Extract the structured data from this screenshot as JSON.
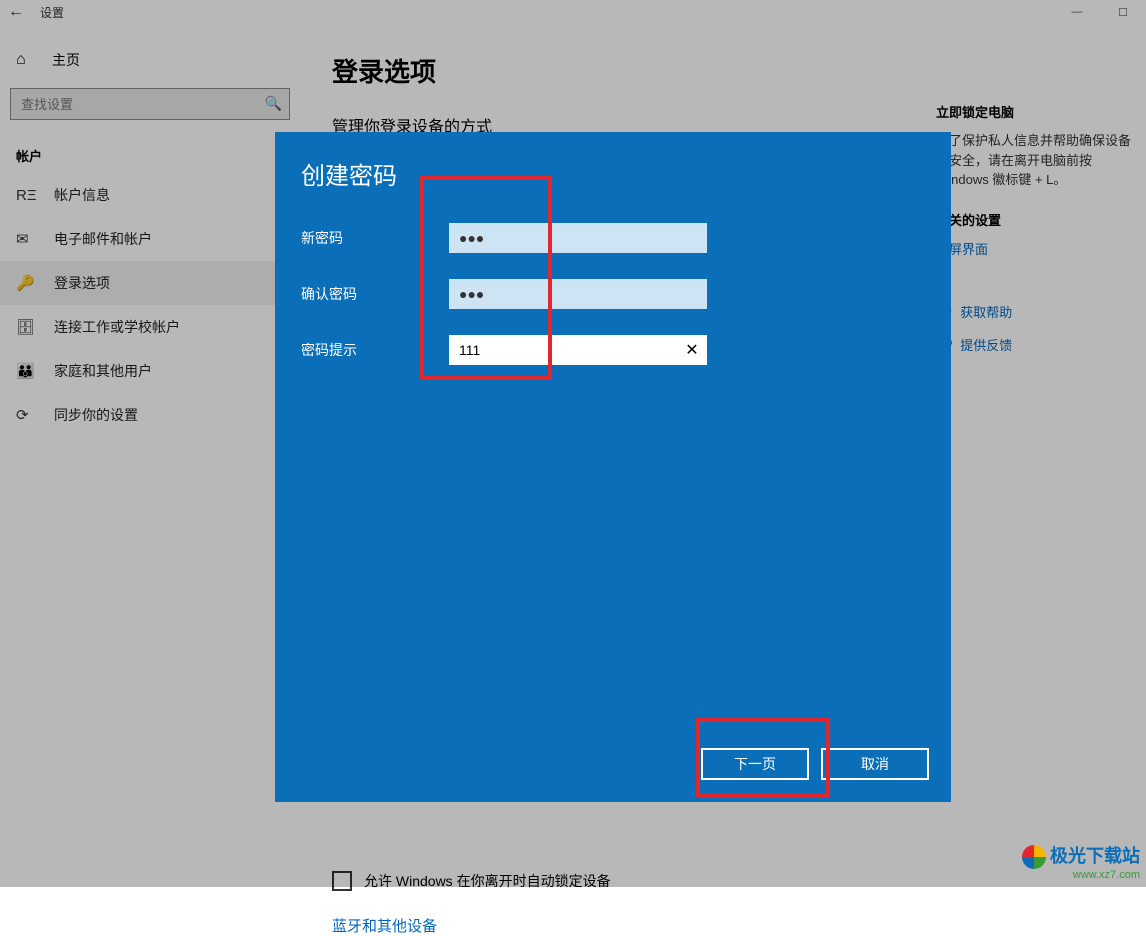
{
  "window": {
    "title": "设置"
  },
  "sidebar": {
    "home": "主页",
    "search_placeholder": "查找设置",
    "section": "帐户",
    "items": [
      {
        "icon": "RΞ",
        "label": "帐户信息"
      },
      {
        "icon": "✉",
        "label": "电子邮件和帐户"
      },
      {
        "icon": "🔑",
        "label": "登录选项"
      },
      {
        "icon": "🗄",
        "label": "连接工作或学校帐户"
      },
      {
        "icon": "👪",
        "label": "家庭和其他用户"
      },
      {
        "icon": "⟳",
        "label": "同步你的设置"
      }
    ]
  },
  "content": {
    "title": "登录选项",
    "subtitle": "管理你登录设备的方式"
  },
  "right": {
    "lock_title": "立即锁定电脑",
    "lock_text": "为了保护私人信息并帮助确保设备的安全，请在离开电脑前按 Windows 徽标键 + L。",
    "related_title": "相关的设置",
    "related_link": "锁屏界面",
    "help": "获取帮助",
    "feedback": "提供反馈"
  },
  "below": {
    "checkbox_label": "允许 Windows 在你离开时自动锁定设备",
    "other_heading": "蓝牙和其他设备"
  },
  "dialog": {
    "title": "创建密码",
    "new_password_label": "新密码",
    "confirm_password_label": "确认密码",
    "hint_label": "密码提示",
    "new_password_value": "●●●",
    "confirm_password_value": "●●●",
    "hint_value": "111",
    "next": "下一页",
    "cancel": "取消"
  },
  "watermark": {
    "text": "极光下载站",
    "url": "www.xz7.com"
  }
}
